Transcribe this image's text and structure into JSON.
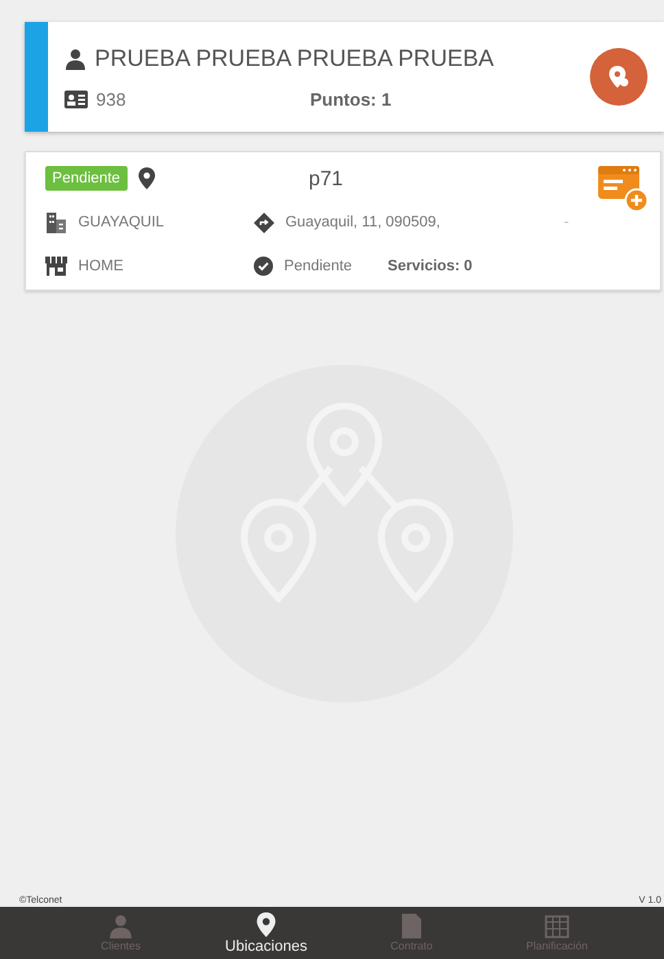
{
  "client": {
    "name": "PRUEBA PRUEBA PRUEBA PRUEBA",
    "id": "938",
    "points_label": "Puntos:",
    "points": "1"
  },
  "locations": [
    {
      "status": "Pendiente",
      "code": "p71",
      "city": "GUAYAQUIL",
      "address": "Guayaquil, 11, 090509,",
      "dash": "-",
      "type": "HOME",
      "state": "Pendiente",
      "services_label": "Servicios:",
      "services": "0"
    }
  ],
  "footer": {
    "copyright": "©Telconet",
    "version": "V 1.0"
  },
  "nav": [
    {
      "label": "Clientes",
      "kind": "person",
      "selected": false
    },
    {
      "label": "Ubicaciones",
      "kind": "pin",
      "selected": true
    },
    {
      "label": "Contrato",
      "kind": "doc",
      "selected": false
    },
    {
      "label": "Planificación",
      "kind": "calendar",
      "selected": false
    }
  ]
}
